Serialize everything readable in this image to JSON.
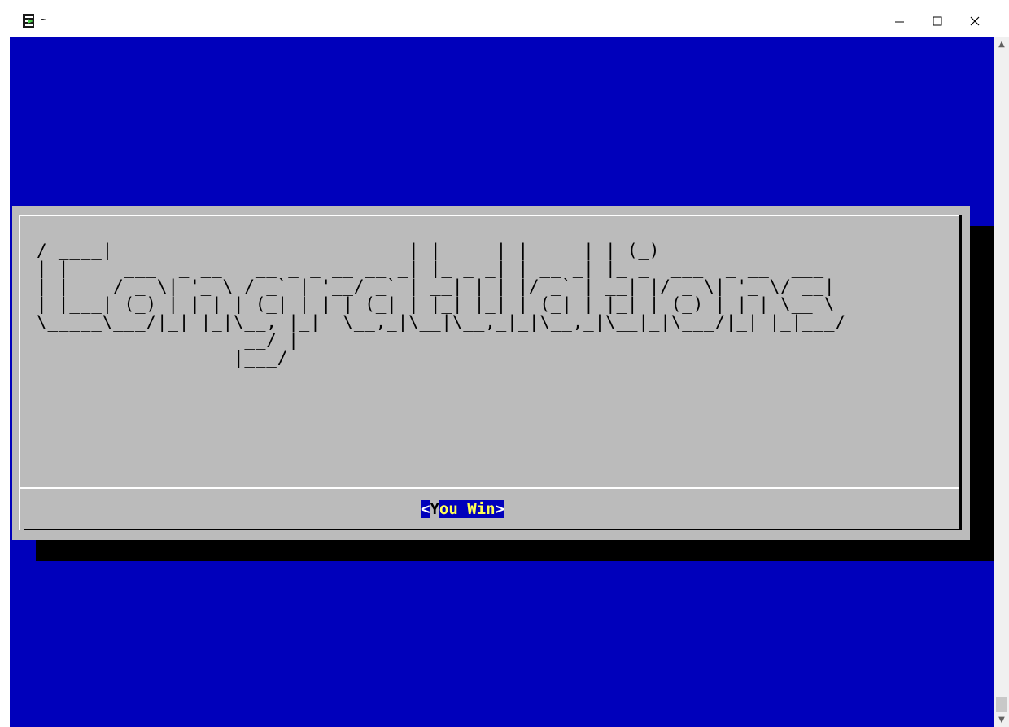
{
  "window": {
    "title": "~",
    "controls": {
      "minimize": "—",
      "maximize": "☐",
      "close": "✕"
    }
  },
  "dialog": {
    "banner": " _____                             _       _       _   _\n/ ____|                           | |     | |     | | (_)\n| |     ___  _ __   __ _ _ __ __ _| |_ _ _| | __ _| |_ _  ___  _ __  ___\n| |    / _ \\| '_ \\ / _` | '__/ _` | __| | | |/ _` | __| |/ _ \\| '_ \\/ __|\n| |___| (_) | | | | (_| | | | (_| | |_| |_| | (_| | |_| | (_) | | | \\__ \\\n\\_____\\___/|_| |_|\\__, |_|  \\__,_|\\__|\\__,_|_|\\__,_|\\__|_|\\___/|_| |_|___/\n                   __/ |\n                  |___/",
    "button": {
      "open": "<",
      "hotkey": "Y",
      "rest": "ou Win",
      "close": ">"
    }
  },
  "scrollbar": {
    "up_arrow": "▲",
    "down_arrow": "▼"
  },
  "colors": {
    "terminal_background": "#0000bb",
    "dialog_background": "#bbbbbb",
    "button_highlight": "#ffff55"
  }
}
